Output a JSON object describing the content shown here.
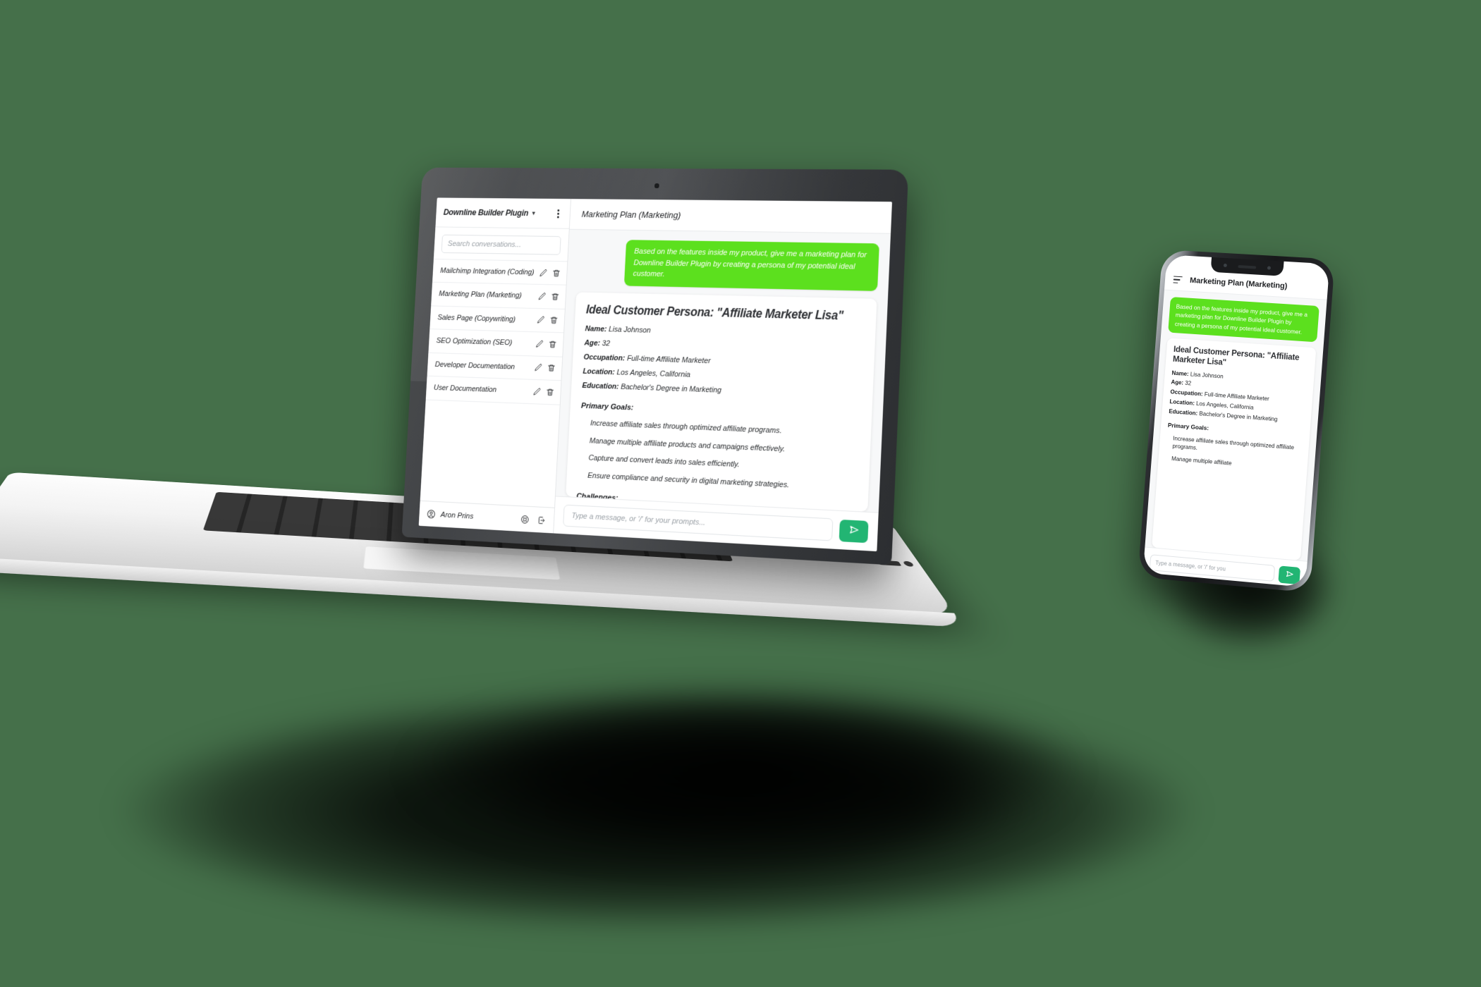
{
  "colors": {
    "background": "#45704a",
    "user_bubble": "#5ce01e",
    "send_button": "#22b573",
    "text": "#1c1e21"
  },
  "laptop": {
    "sidebar": {
      "project_title": "Downline Builder Plugin",
      "chevron_icon": "chevron-down-icon",
      "kebab_icon": "kebab-menu-icon",
      "search": {
        "placeholder": "Search conversations...",
        "value": ""
      },
      "conversations": [
        {
          "label": "Mailchimp Integration (Coding)",
          "edit_icon": "pencil-icon",
          "delete_icon": "trash-icon"
        },
        {
          "label": "Marketing Plan (Marketing)",
          "edit_icon": "pencil-icon",
          "delete_icon": "trash-icon"
        },
        {
          "label": "Sales Page (Copywriting)",
          "edit_icon": "pencil-icon",
          "delete_icon": "trash-icon"
        },
        {
          "label": "SEO Optimization (SEO)",
          "edit_icon": "pencil-icon",
          "delete_icon": "trash-icon"
        },
        {
          "label": "Developer Documentation",
          "edit_icon": "pencil-icon",
          "delete_icon": "trash-icon"
        },
        {
          "label": "User Documentation",
          "edit_icon": "pencil-icon",
          "delete_icon": "trash-icon"
        }
      ],
      "footer": {
        "avatar_icon": "user-circle-icon",
        "user_name": "Aron Prins",
        "help_icon": "life-buoy-icon",
        "logout_icon": "logout-icon"
      }
    },
    "main": {
      "title": "Marketing Plan (Marketing)",
      "user_message": "Based on the features inside my product, give me a marketing plan for Downline Builder Plugin by creating a persona of my potential ideal customer.",
      "response": {
        "heading": "Ideal Customer Persona: \"Affiliate Marketer Lisa\"",
        "fields": [
          {
            "key": "Name:",
            "value": "Lisa Johnson"
          },
          {
            "key": "Age:",
            "value": "32"
          },
          {
            "key": "Occupation:",
            "value": "Full-time Affiliate Marketer"
          },
          {
            "key": "Location:",
            "value": "Los Angeles, California"
          },
          {
            "key": "Education:",
            "value": "Bachelor's Degree in Marketing"
          }
        ],
        "goals_heading": "Primary Goals:",
        "goals": [
          "Increase affiliate sales through optimized affiliate programs.",
          "Manage multiple affiliate products and campaigns effectively.",
          "Capture and convert leads into sales efficiently.",
          "Ensure compliance and security in digital marketing strategies."
        ],
        "challenges_heading": "Challenges:"
      },
      "composer": {
        "placeholder": "Type a message, or '/' for your prompts...",
        "value": "",
        "send_icon": "send-paper-plane-icon"
      }
    }
  },
  "phone": {
    "menu_icon": "hamburger-menu-icon",
    "title": "Marketing Plan (Marketing)",
    "user_message": "Based on the features inside my product, give me a marketing plan for Downline Builder Plugin by creating a persona of my potential ideal customer.",
    "response": {
      "heading": "Ideal Customer Persona: \"Affiliate Marketer Lisa\"",
      "fields": [
        {
          "key": "Name:",
          "value": "Lisa Johnson"
        },
        {
          "key": "Age:",
          "value": "32"
        },
        {
          "key": "Occupation:",
          "value": "Full-time Affiliate Marketer"
        },
        {
          "key": "Location:",
          "value": "Los Angeles, California"
        },
        {
          "key": "Education:",
          "value": "Bachelor's Degree in Marketing"
        }
      ],
      "goals_heading": "Primary Goals:",
      "goals": [
        "Increase affiliate sales through optimized affiliate programs.",
        "Manage multiple affiliate"
      ]
    },
    "composer": {
      "placeholder": "Type a message, or '/' for you",
      "value": "",
      "send_icon": "send-paper-plane-icon"
    }
  }
}
